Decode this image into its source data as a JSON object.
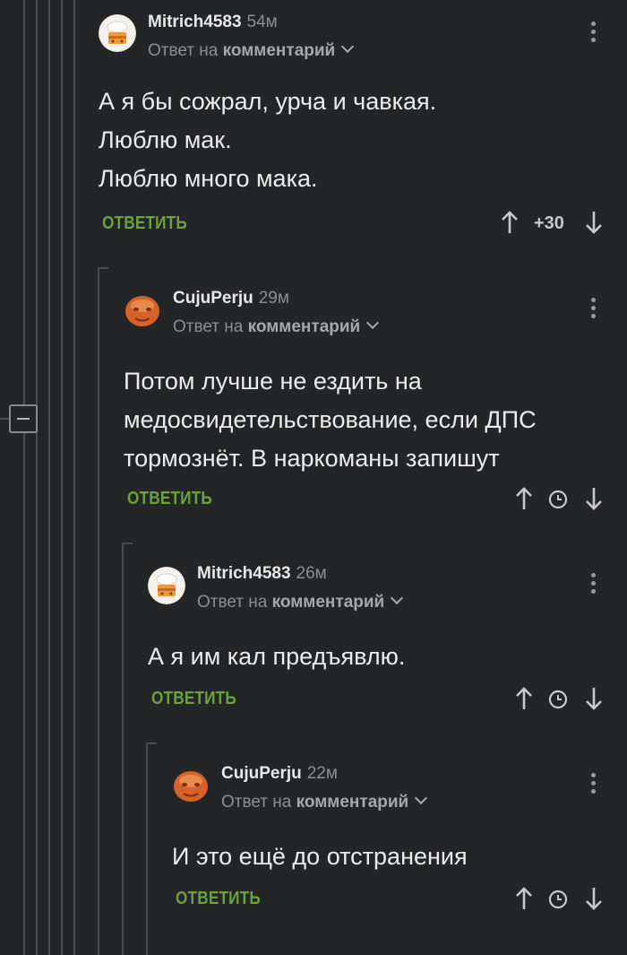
{
  "reply_prefix": "Ответ на",
  "reply_target": "комментарий",
  "reply_label": "ОТВЕТИТЬ",
  "colors": {
    "background": "#242527",
    "accent_green": "#6aa23c",
    "muted_text": "#8d8e91",
    "thread_line": "#4a4b4e"
  },
  "comments": [
    {
      "author": "Mitrich4583",
      "time": "54м",
      "avatar_icon": "chef-cake-avatar-icon",
      "text_lines": [
        "А я бы сожрал, урча и чавкая.",
        "Люблю мак.",
        "Люблю много мака."
      ],
      "rating": "+30"
    },
    {
      "author": "CujuPerju",
      "time": "29м",
      "avatar_icon": "orange-face-avatar-icon",
      "text_lines": [
        "Потом лучше не ездить на",
        "медосвидетельствование, если ДПС",
        "тормознёт. В наркоманы запишут"
      ],
      "rating_icon": "clock-icon"
    },
    {
      "author": "Mitrich4583",
      "time": "26м",
      "avatar_icon": "chef-cake-avatar-icon",
      "text_lines": [
        "А я им кал предъявлю."
      ],
      "rating_icon": "clock-icon"
    },
    {
      "author": "CujuPerju",
      "time": "22м",
      "avatar_icon": "orange-face-avatar-icon",
      "text_lines": [
        "И это ещё до отстранения"
      ],
      "rating_icon": "clock-icon"
    }
  ]
}
